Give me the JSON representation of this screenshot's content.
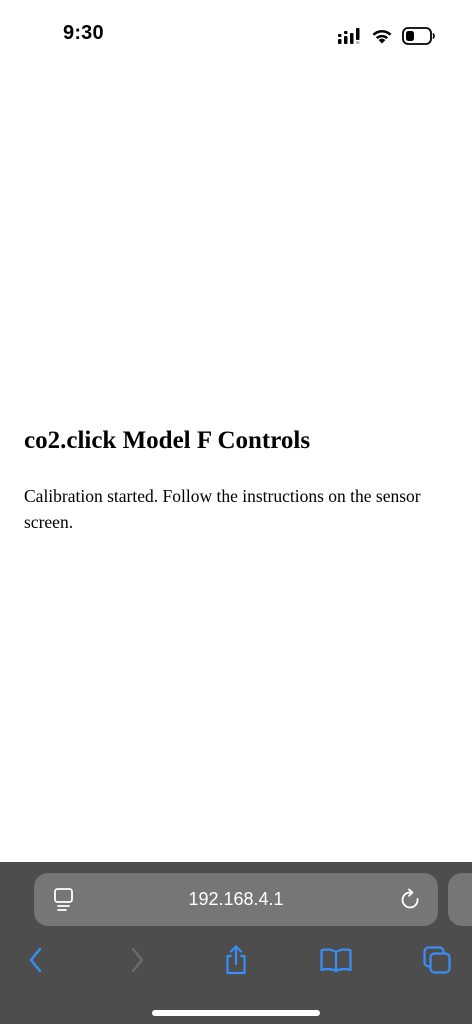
{
  "status_bar": {
    "time": "9:30",
    "icons": [
      "cellular-signal-icon",
      "wifi-icon",
      "battery-icon"
    ]
  },
  "page": {
    "heading": "co2.click Model F Controls",
    "message": "Calibration started. Follow the instructions on the sensor screen."
  },
  "browser": {
    "url": "192.168.4.1",
    "toolbar_icons": [
      "back-icon",
      "forward-icon",
      "share-icon",
      "bookmarks-icon",
      "tabs-icon"
    ],
    "accent_color": "#3a8ef7",
    "toolbar_color": "#4d4d4d",
    "address_bar_color": "#767676"
  }
}
